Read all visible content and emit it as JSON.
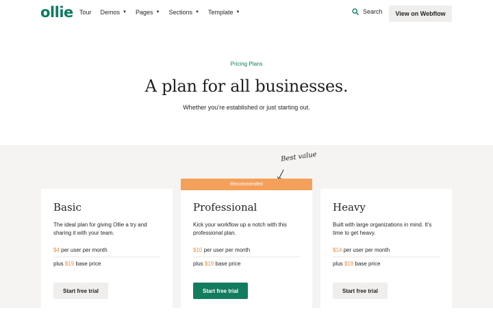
{
  "nav": {
    "logo": "ollie",
    "links": [
      {
        "label": "Tour",
        "dropdown": false
      },
      {
        "label": "Demos",
        "dropdown": true
      },
      {
        "label": "Pages",
        "dropdown": true
      },
      {
        "label": "Sections",
        "dropdown": true
      },
      {
        "label": "Template",
        "dropdown": true
      }
    ],
    "search_label": "Search",
    "cta_label": "View on Webflow"
  },
  "hero": {
    "eyebrow": "Pricing Plans",
    "title": "A plan for all businesses.",
    "subtitle": "Whether you’re established or just starting out."
  },
  "annotation": "Best value",
  "plans": [
    {
      "name": "Basic",
      "description": "The ideal plan for giving Ollie a try and sharing it with your team.",
      "per_user_price": "$4",
      "per_user_suffix": " per user per month",
      "base_prefix": "plus ",
      "base_price": "$19",
      "base_suffix": " base price",
      "cta": "Start free trial",
      "recommended": false
    },
    {
      "name": "Professional",
      "badge": "Recommended",
      "description": "Kick your workflow up a notch with this professional plan.",
      "per_user_price": "$10",
      "per_user_suffix": " per user per month",
      "base_prefix": "plus ",
      "base_price": "$19",
      "base_suffix": " base price",
      "cta": "Start free trial",
      "recommended": true
    },
    {
      "name": "Heavy",
      "description": "Built with large organizations in mind. It’s time to get heavy.",
      "per_user_price": "$14",
      "per_user_suffix": " per user per month",
      "base_prefix": "plus ",
      "base_price": "$19",
      "base_suffix": " base price",
      "cta": "Start free trial",
      "recommended": false
    }
  ],
  "colors": {
    "brand": "#0e7a5f",
    "accent": "#f08a3c",
    "badge": "#f5a05a",
    "band_bg": "#f5f4f2"
  }
}
